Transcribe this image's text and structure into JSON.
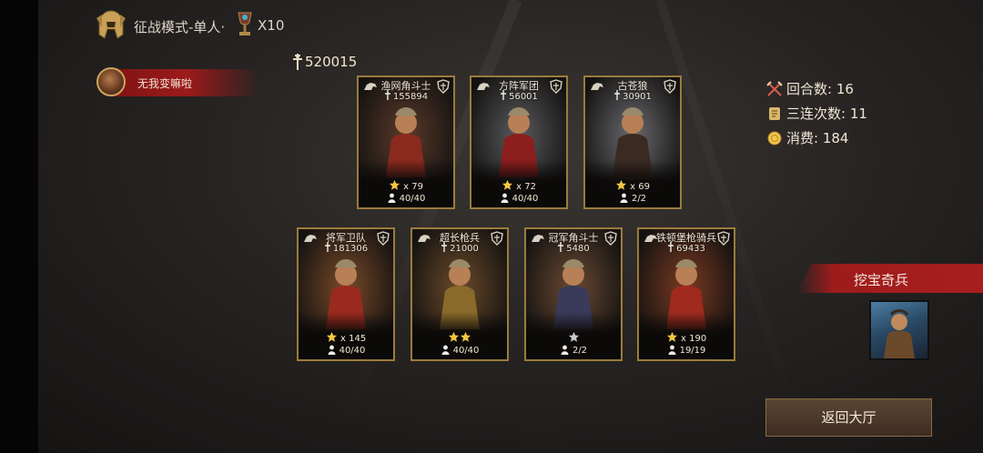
{
  "header": {
    "mode_title": "征战模式-单人·",
    "multiplier": "X10",
    "icons": [
      "helmet-icon",
      "trophy-icon"
    ]
  },
  "power_total": "520015",
  "player": {
    "name": "无我变嘛啦"
  },
  "stats": {
    "rounds": "回合数: 16",
    "streak": "三连次数: 11",
    "cost": "消费: 184"
  },
  "cards": [
    {
      "name": "渔网角斗士",
      "power": "155894",
      "stars": "x 79",
      "troops": "40/40"
    },
    {
      "name": "方阵军团",
      "power": "56001",
      "stars": "x 72",
      "troops": "40/40"
    },
    {
      "name": "古苍狼",
      "power": "30901",
      "stars": "x 69",
      "troops": "2/2"
    },
    {
      "name": "将军卫队",
      "power": "181306",
      "stars": "x 145",
      "troops": "40/40"
    },
    {
      "name": "超长枪兵",
      "power": "21000",
      "stars": "",
      "star_count": 2,
      "troops": "40/40"
    },
    {
      "name": "冠军角斗士",
      "power": "5480",
      "stars": "",
      "star_count": 1,
      "star_color": "silver",
      "troops": "2/2"
    },
    {
      "name": "铁顿堡枪骑兵",
      "power": "69433",
      "stars": "x 190",
      "troops": "19/19"
    }
  ],
  "event": {
    "label": "挖宝奇兵"
  },
  "back_button": "返回大厅",
  "colors": {
    "accent_red": "#a81e1e",
    "gold_border": "#9b7b3c",
    "gold_star": "#f3c640"
  }
}
